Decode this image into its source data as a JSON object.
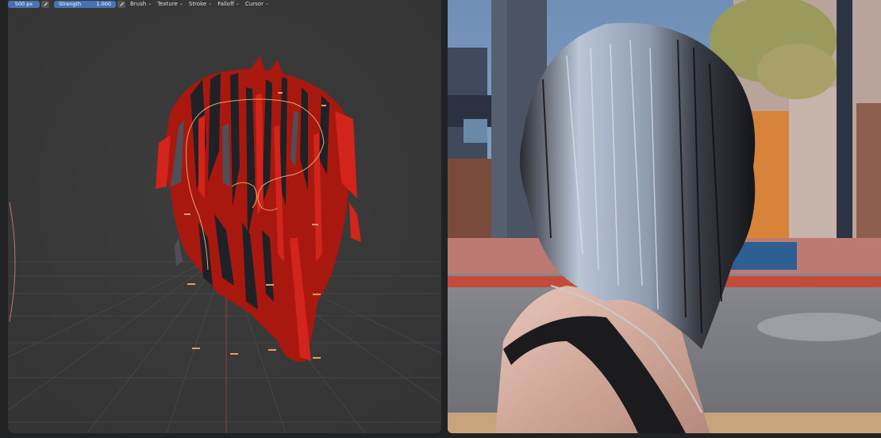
{
  "toolbar": {
    "radius_value": "500 px",
    "strength_label": "Strength",
    "strength_value": "1.000",
    "menus": [
      {
        "label": "Brush"
      },
      {
        "label": "Texture"
      },
      {
        "label": "Stroke"
      },
      {
        "label": "Falloff"
      },
      {
        "label": "Cursor"
      }
    ]
  },
  "colors": {
    "viewport_bg": "#3a3a3a",
    "field_blue": "#4772b3",
    "hair_red": "#b81c14",
    "hair_dark": "#1d1f24",
    "outline": "#e0a060"
  }
}
